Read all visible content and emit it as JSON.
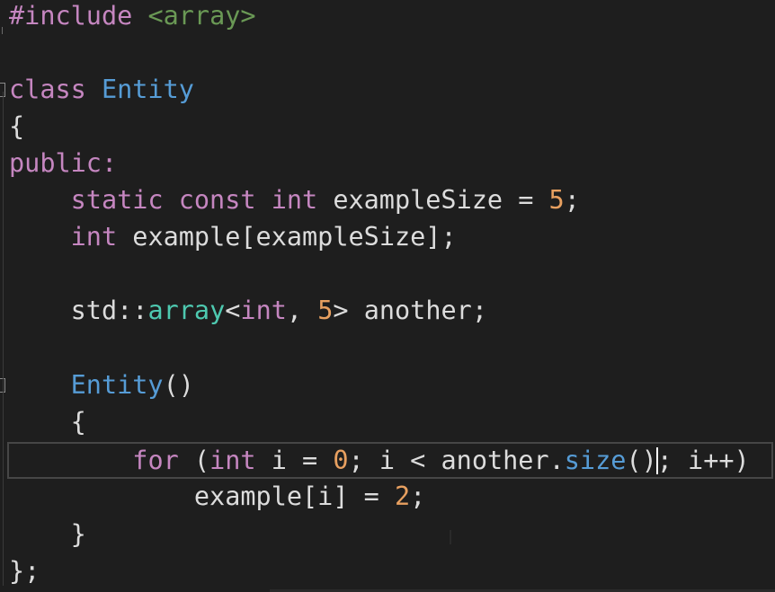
{
  "editor": {
    "lines": [
      {
        "id": "l1",
        "tokens": [
          {
            "t": "#include ",
            "c": "inc"
          },
          {
            "t": "<array>",
            "c": "str"
          }
        ]
      },
      {
        "id": "l2",
        "tokens": []
      },
      {
        "id": "l3",
        "tokens": [
          {
            "t": "class ",
            "c": "kw2"
          },
          {
            "t": "Entity",
            "c": "cls"
          }
        ]
      },
      {
        "id": "l4",
        "tokens": [
          {
            "t": "{",
            "c": "plain"
          }
        ]
      },
      {
        "id": "l5",
        "tokens": [
          {
            "t": "public:",
            "c": "kw2"
          }
        ]
      },
      {
        "id": "l6",
        "tokens": [
          {
            "t": "    static const int ",
            "c": "kw2"
          },
          {
            "t": "exampleSize = ",
            "c": "plain"
          },
          {
            "t": "5",
            "c": "num"
          },
          {
            "t": ";",
            "c": "plain"
          }
        ]
      },
      {
        "id": "l7",
        "tokens": [
          {
            "t": "    int ",
            "c": "kw2"
          },
          {
            "t": "example[exampleSize];",
            "c": "plain"
          }
        ]
      },
      {
        "id": "l8",
        "tokens": []
      },
      {
        "id": "l9",
        "tokens": [
          {
            "t": "    std::",
            "c": "plain"
          },
          {
            "t": "array",
            "c": "type"
          },
          {
            "t": "<",
            "c": "plain"
          },
          {
            "t": "int",
            "c": "kw2"
          },
          {
            "t": ", ",
            "c": "plain"
          },
          {
            "t": "5",
            "c": "num"
          },
          {
            "t": "> another;",
            "c": "plain"
          }
        ]
      },
      {
        "id": "l10",
        "tokens": []
      },
      {
        "id": "l11",
        "tokens": [
          {
            "t": "    ",
            "c": "plain"
          },
          {
            "t": "Entity",
            "c": "fn"
          },
          {
            "t": "()",
            "c": "plain"
          }
        ]
      },
      {
        "id": "l12",
        "tokens": [
          {
            "t": "    {",
            "c": "plain"
          }
        ]
      },
      {
        "id": "l13",
        "tokens": [
          {
            "t": "        ",
            "c": "plain"
          },
          {
            "t": "for",
            "c": "kw2"
          },
          {
            "t": " (",
            "c": "plain"
          },
          {
            "t": "int",
            "c": "kw2"
          },
          {
            "t": " i = ",
            "c": "plain"
          },
          {
            "t": "0",
            "c": "num"
          },
          {
            "t": "; i < another.",
            "c": "plain"
          },
          {
            "t": "size",
            "c": "fn"
          },
          {
            "t": "()",
            "c": "plain"
          },
          {
            "t": "|",
            "c": "caret"
          },
          {
            "t": "; i++)",
            "c": "plain"
          }
        ]
      },
      {
        "id": "l14",
        "tokens": [
          {
            "t": "            example[i] = ",
            "c": "plain"
          },
          {
            "t": "2",
            "c": "num"
          },
          {
            "t": ";",
            "c": "plain"
          }
        ]
      },
      {
        "id": "l15",
        "tokens": [
          {
            "t": "    }",
            "c": "plain"
          }
        ]
      },
      {
        "id": "l16",
        "tokens": [
          {
            "t": "};",
            "c": "plain"
          }
        ]
      }
    ]
  }
}
